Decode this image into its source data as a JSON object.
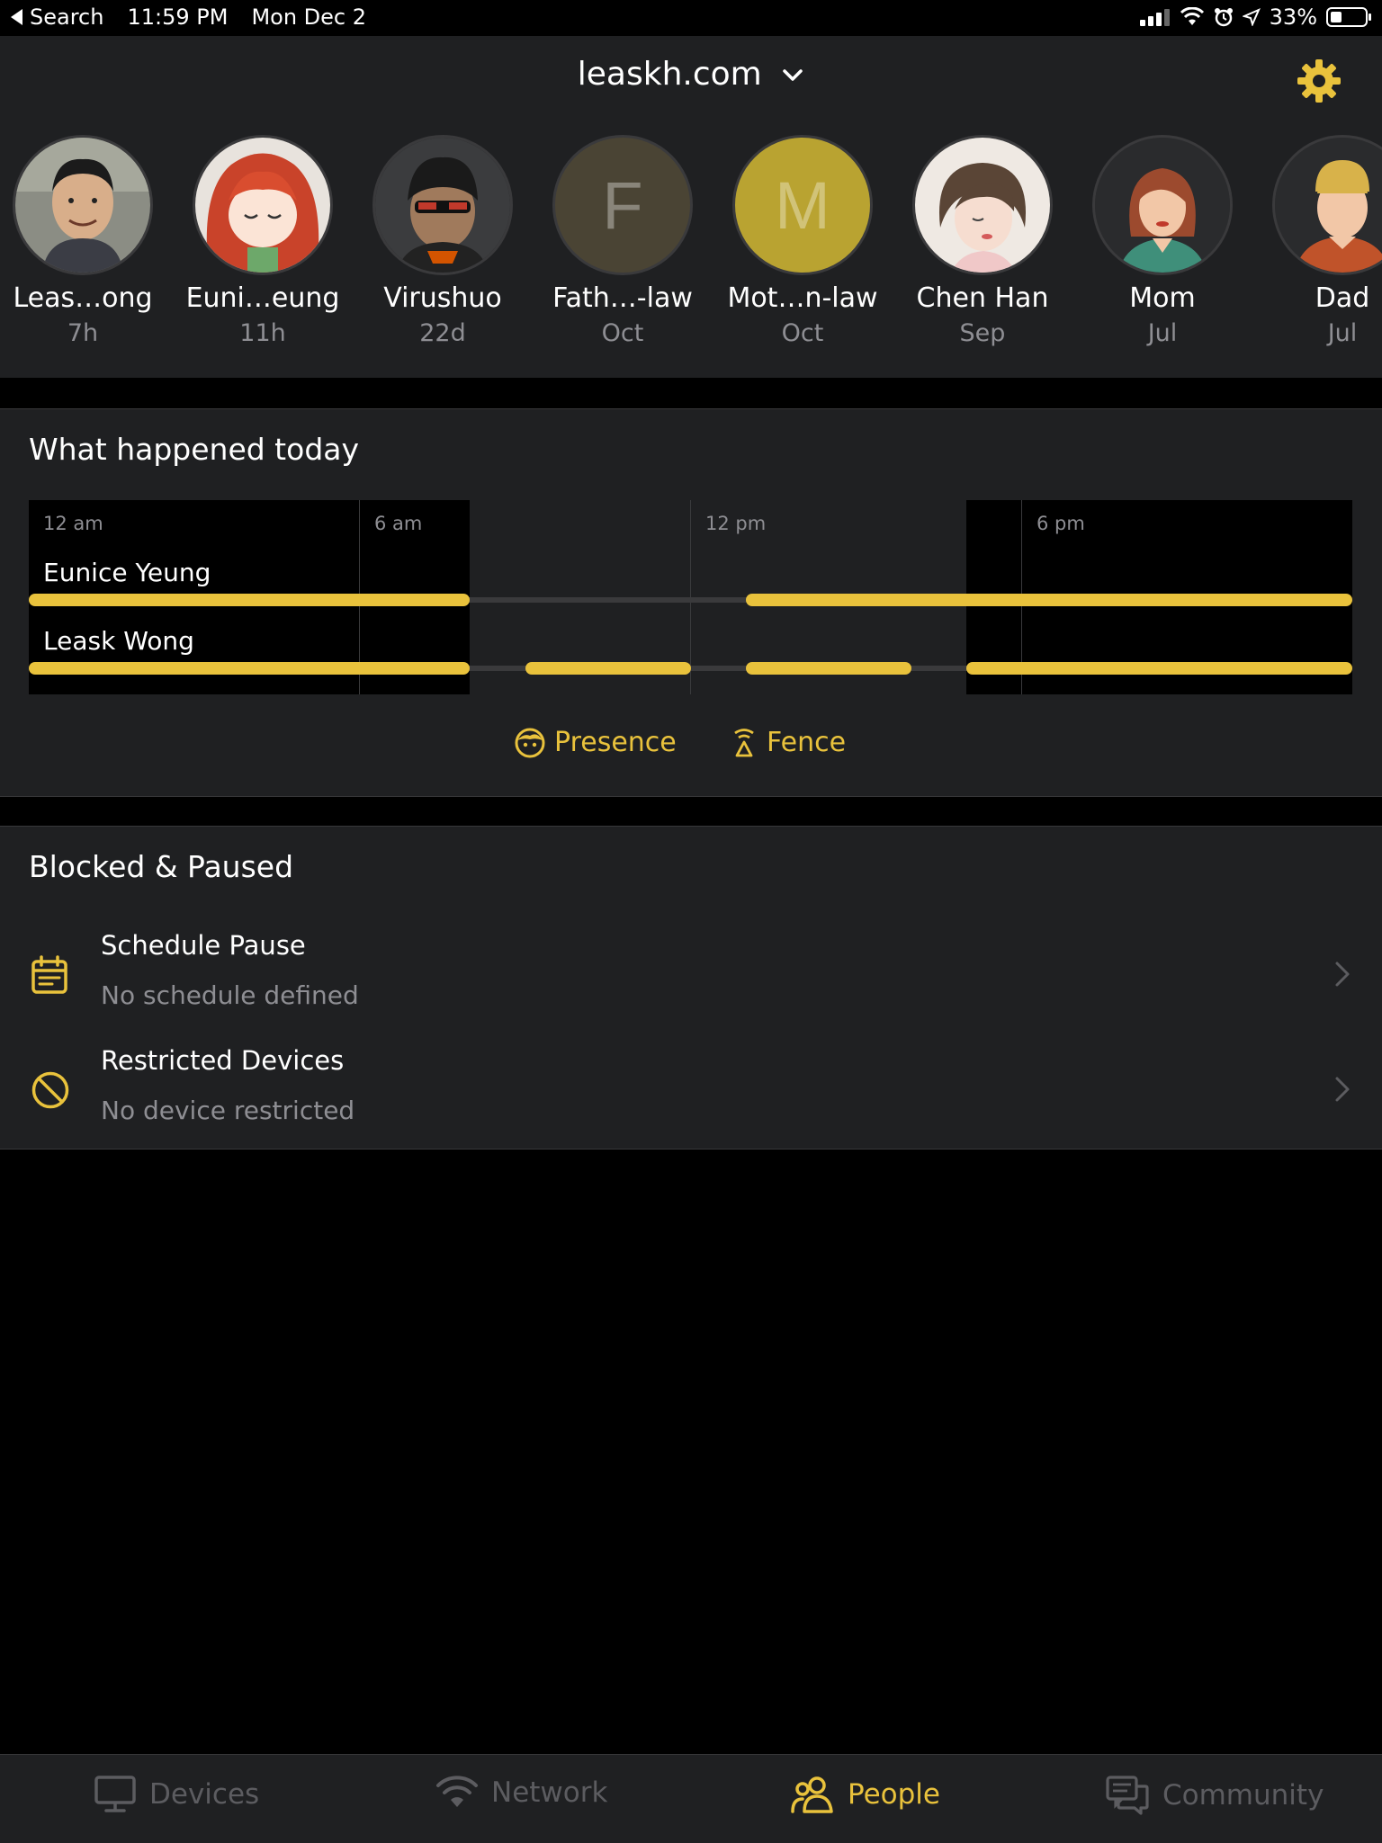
{
  "status_bar": {
    "back_label": "Search",
    "time": "11:59 PM",
    "date": "Mon Dec 2",
    "battery_percent": "33%",
    "battery_level": 0.33
  },
  "header": {
    "domain": "leaskh.com"
  },
  "people": [
    {
      "name": "Leas…ong",
      "time": "7h",
      "avatar": "photo-young-man"
    },
    {
      "name": "Euni…eung",
      "time": "11h",
      "avatar": "anime-girl-red-hair"
    },
    {
      "name": "Virushuo",
      "time": "22d",
      "avatar": "photo-man-sunglasses"
    },
    {
      "name": "Fath…-law",
      "time": "Oct",
      "avatar": "letter",
      "letter": "F",
      "color": "#4a4434"
    },
    {
      "name": "Mot…n-law",
      "time": "Oct",
      "avatar": "letter",
      "letter": "M",
      "color": "#b9a331"
    },
    {
      "name": "Chen Han",
      "time": "Sep",
      "avatar": "illustrated-woman-short-hair"
    },
    {
      "name": "Mom",
      "time": "Jul",
      "avatar": "cartoon-woman"
    },
    {
      "name": "Dad",
      "time": "Jul",
      "avatar": "cartoon-man"
    }
  ],
  "today": {
    "title": "What happened today",
    "hours": [
      "12 am",
      "6 am",
      "12 pm",
      "6 pm"
    ],
    "rows": [
      {
        "name": "Eunice Yeung"
      },
      {
        "name": "Leask Wong"
      }
    ],
    "legend": {
      "presence": "Presence",
      "fence": "Fence"
    }
  },
  "blocked": {
    "title": "Blocked & Paused",
    "items": [
      {
        "title": "Schedule Pause",
        "subtitle": "No schedule defined",
        "icon": "calendar-icon"
      },
      {
        "title": "Restricted Devices",
        "subtitle": "No device restricted",
        "icon": "block-icon"
      }
    ]
  },
  "tabs": [
    {
      "label": "Devices",
      "icon": "monitor-icon",
      "active": false
    },
    {
      "label": "Network",
      "icon": "wifi-icon",
      "active": false
    },
    {
      "label": "People",
      "icon": "people-icon",
      "active": true
    },
    {
      "label": "Community",
      "icon": "chat-icon",
      "active": false
    }
  ],
  "colors": {
    "accent": "#e9c23c",
    "panel": "#1f2022",
    "muted": "#8e8e93"
  }
}
